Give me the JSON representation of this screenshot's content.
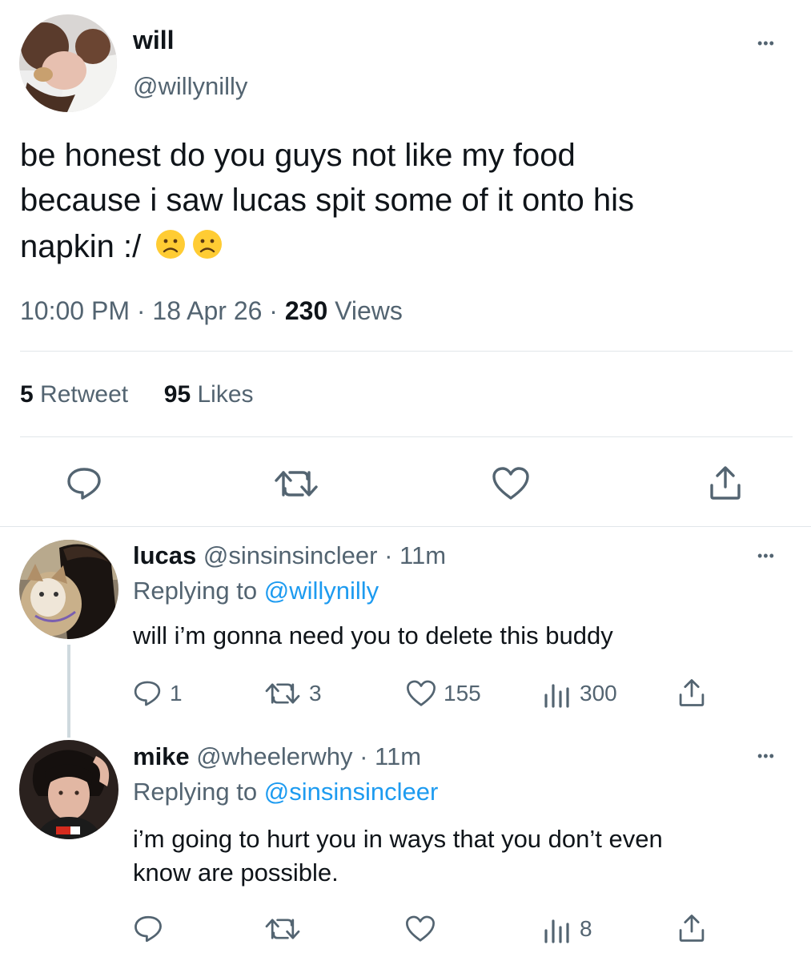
{
  "main_tweet": {
    "display_name": "will",
    "handle": "@willynilly",
    "text_line1": "be honest do you guys not like my food",
    "text_line2": "because i saw lucas spit some of it onto his",
    "text_line3": "napkin :/",
    "emoji": "🙁🙁",
    "time": "10:00 PM",
    "date": "18 Apr 26",
    "views_count": "230",
    "views_label": "Views",
    "retweets_count": "5",
    "retweets_label": "Retweet",
    "likes_count": "95",
    "likes_label": "Likes",
    "more_label": "•••"
  },
  "replies": [
    {
      "display_name": "lucas",
      "handle": "@sinsinsincleer",
      "time": "11m",
      "replying_prefix": "Replying to",
      "replying_to": "@willynilly",
      "text_line1": "will i’m gonna need you to delete this buddy",
      "text_line2": "",
      "reply_count": "1",
      "retweet_count": "3",
      "like_count": "155",
      "views_count": "300",
      "more_label": "•••"
    },
    {
      "display_name": "mike",
      "handle": "@wheelerwhy",
      "time": "11m",
      "replying_prefix": "Replying to",
      "replying_to": "@sinsinsincleer",
      "text_line1": "i’m going to hurt you in ways that you don’t even",
      "text_line2": "know are possible.",
      "reply_count": "",
      "retweet_count": "",
      "like_count": "",
      "views_count": "8",
      "more_label": "•••"
    }
  ],
  "colors": {
    "text": "#0f1419",
    "muted": "#536471",
    "link": "#1d9bf0",
    "divider": "#e1e6ea"
  },
  "icons": [
    "reply-icon",
    "retweet-icon",
    "like-icon",
    "share-icon",
    "views-icon",
    "more-icon"
  ]
}
